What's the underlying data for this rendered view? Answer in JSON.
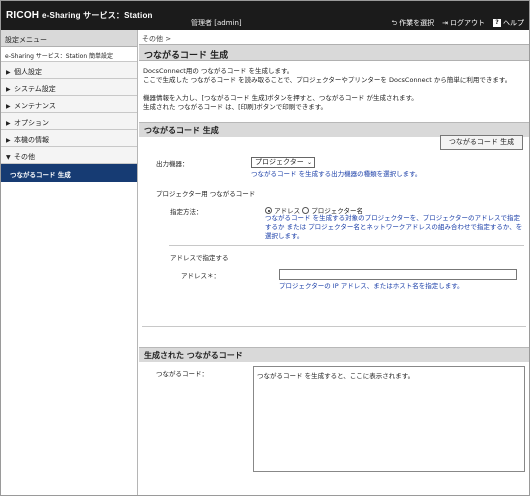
{
  "header": {
    "brand_ricoh": "RICOH",
    "brand_rest": "e-Sharing サービス：Station",
    "admin": "管理者 [admin]",
    "links": {
      "select_task": "作業を選択",
      "logout": "ログアウト",
      "help": "ヘルプ",
      "help_glyph": "?"
    }
  },
  "sidebar": {
    "title": "設定メニュー",
    "subtitle": "e-Sharing サービス：Station 簡単設定",
    "items": [
      {
        "label": "個人設定",
        "arrow": "▶"
      },
      {
        "label": "システム設定",
        "arrow": "▶"
      },
      {
        "label": "メンテナンス",
        "arrow": "▶"
      },
      {
        "label": "オプション",
        "arrow": "▶"
      },
      {
        "label": "本機の情報",
        "arrow": "▶"
      },
      {
        "label": "その他",
        "arrow": "▼"
      }
    ],
    "active": "つながるコード 生成"
  },
  "main": {
    "breadcrumb": "その他 >",
    "page_title": "つながるコード 生成",
    "intro1": "DocsConnect用の つながるコード を生成します。",
    "intro2": "ここで生成した つながるコード を読み取ることで、プロジェクターやプリンターを DocsConnect から簡単に利用できます。",
    "intro3": "機器情報を入力し、[つながるコード 生成]ボタンを押すと、つながるコード が生成されます。",
    "intro4": "生成された つながるコード は、[印刷]ボタンで印刷できます。",
    "section1": "つながるコード 生成",
    "generate_button": "つながるコード 生成",
    "output_device_label": "出力機器：",
    "output_device_value": "プロジェクター",
    "output_device_help": "つながるコード を生成する出力機器の種類を選択します。",
    "projector_group": "プロジェクター用 つながるコード",
    "spec_method_label": "指定方法：",
    "radio_address": "アドレス",
    "radio_name": "プロジェクター名",
    "spec_help1": "つながるコード を生成する対象のプロジェクターを、プロジェクターのアドレスで指定",
    "spec_help2": "するか または プロジェクター名とネットワークアドレスの組み合わせで指定するか、を",
    "spec_help3": "選択します。",
    "address_group": "アドレスで指定する",
    "address_label": "アドレス＊：",
    "address_value": "",
    "address_help": "プロジェクターの IP アドレス、またはホスト名を指定します。",
    "section2": "生成された つながるコード",
    "code_label": "つながるコード：",
    "code_text": "つながるコード を生成すると、ここに表示されます。"
  }
}
